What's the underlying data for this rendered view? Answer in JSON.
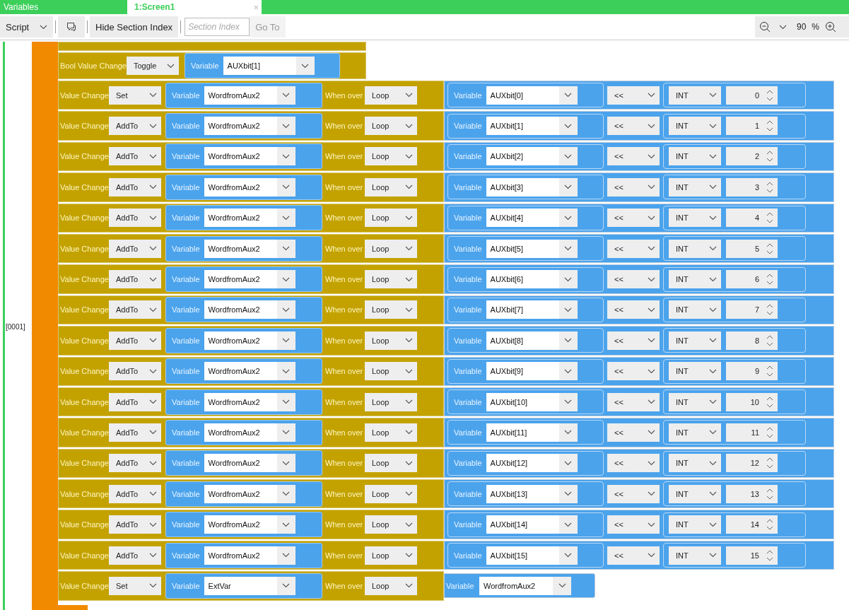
{
  "tabs": [
    {
      "label": "Variables",
      "selected": false
    },
    {
      "label": "1:Screen1",
      "selected": true,
      "close": "×"
    }
  ],
  "toolbar": {
    "mode": "Script",
    "hide_button": "Hide Section Index",
    "section_placeholder": "Section Index",
    "goto": "Go To",
    "goto_disabled": true,
    "zoom": "90",
    "zoom_unit": "%"
  },
  "section_label": "[0001]",
  "blocks": [
    {
      "kind": "partial"
    },
    {
      "kind": "bool",
      "label": "Bool Value Change",
      "op": "Toggle",
      "var_label": "Variable",
      "variable": "AUXbit[1]"
    },
    {
      "kind": "value",
      "label": "Value Change",
      "op": "Set",
      "var_label": "Variable",
      "variable": "WordfromAux2",
      "over_label": "When over",
      "over": "Loop",
      "rhs": {
        "kind": "shift",
        "var_label": "Variable",
        "variable": "AUXbit[0]",
        "operator": "<<",
        "type": "INT",
        "amount": "0"
      }
    },
    {
      "kind": "value",
      "label": "Value Change",
      "op": "AddTo",
      "var_label": "Variable",
      "variable": "WordfromAux2",
      "over_label": "When over",
      "over": "Loop",
      "rhs": {
        "kind": "shift",
        "var_label": "Variable",
        "variable": "AUXbit[1]",
        "operator": "<<",
        "type": "INT",
        "amount": "1"
      }
    },
    {
      "kind": "value",
      "label": "Value Change",
      "op": "AddTo",
      "var_label": "Variable",
      "variable": "WordfromAux2",
      "over_label": "When over",
      "over": "Loop",
      "rhs": {
        "kind": "shift",
        "var_label": "Variable",
        "variable": "AUXbit[2]",
        "operator": "<<",
        "type": "INT",
        "amount": "2"
      }
    },
    {
      "kind": "value",
      "label": "Value Change",
      "op": "AddTo",
      "var_label": "Variable",
      "variable": "WordfromAux2",
      "over_label": "When over",
      "over": "Loop",
      "rhs": {
        "kind": "shift",
        "var_label": "Variable",
        "variable": "AUXbit[3]",
        "operator": "<<",
        "type": "INT",
        "amount": "3"
      }
    },
    {
      "kind": "value",
      "label": "Value Change",
      "op": "AddTo",
      "var_label": "Variable",
      "variable": "WordfromAux2",
      "over_label": "When over",
      "over": "Loop",
      "rhs": {
        "kind": "shift",
        "var_label": "Variable",
        "variable": "AUXbit[4]",
        "operator": "<<",
        "type": "INT",
        "amount": "4"
      }
    },
    {
      "kind": "value",
      "label": "Value Change",
      "op": "AddTo",
      "var_label": "Variable",
      "variable": "WordfromAux2",
      "over_label": "When over",
      "over": "Loop",
      "rhs": {
        "kind": "shift",
        "var_label": "Variable",
        "variable": "AUXbit[5]",
        "operator": "<<",
        "type": "INT",
        "amount": "5"
      }
    },
    {
      "kind": "value",
      "label": "Value Change",
      "op": "AddTo",
      "var_label": "Variable",
      "variable": "WordfromAux2",
      "over_label": "When over",
      "over": "Loop",
      "rhs": {
        "kind": "shift",
        "var_label": "Variable",
        "variable": "AUXbit[6]",
        "operator": "<<",
        "type": "INT",
        "amount": "6"
      }
    },
    {
      "kind": "value",
      "label": "Value Change",
      "op": "AddTo",
      "var_label": "Variable",
      "variable": "WordfromAux2",
      "over_label": "When over",
      "over": "Loop",
      "rhs": {
        "kind": "shift",
        "var_label": "Variable",
        "variable": "AUXbit[7]",
        "operator": "<<",
        "type": "INT",
        "amount": "7"
      }
    },
    {
      "kind": "value",
      "label": "Value Change",
      "op": "AddTo",
      "var_label": "Variable",
      "variable": "WordfromAux2",
      "over_label": "When over",
      "over": "Loop",
      "rhs": {
        "kind": "shift",
        "var_label": "Variable",
        "variable": "AUXbit[8]",
        "operator": "<<",
        "type": "INT",
        "amount": "8"
      }
    },
    {
      "kind": "value",
      "label": "Value Change",
      "op": "AddTo",
      "var_label": "Variable",
      "variable": "WordfromAux2",
      "over_label": "When over",
      "over": "Loop",
      "rhs": {
        "kind": "shift",
        "var_label": "Variable",
        "variable": "AUXbit[9]",
        "operator": "<<",
        "type": "INT",
        "amount": "9"
      }
    },
    {
      "kind": "value",
      "label": "Value Change",
      "op": "AddTo",
      "var_label": "Variable",
      "variable": "WordfromAux2",
      "over_label": "When over",
      "over": "Loop",
      "rhs": {
        "kind": "shift",
        "var_label": "Variable",
        "variable": "AUXbit[10]",
        "operator": "<<",
        "type": "INT",
        "amount": "10"
      }
    },
    {
      "kind": "value",
      "label": "Value Change",
      "op": "AddTo",
      "var_label": "Variable",
      "variable": "WordfromAux2",
      "over_label": "When over",
      "over": "Loop",
      "rhs": {
        "kind": "shift",
        "var_label": "Variable",
        "variable": "AUXbit[11]",
        "operator": "<<",
        "type": "INT",
        "amount": "11"
      }
    },
    {
      "kind": "value",
      "label": "Value Change",
      "op": "AddTo",
      "var_label": "Variable",
      "variable": "WordfromAux2",
      "over_label": "When over",
      "over": "Loop",
      "rhs": {
        "kind": "shift",
        "var_label": "Variable",
        "variable": "AUXbit[12]",
        "operator": "<<",
        "type": "INT",
        "amount": "12"
      }
    },
    {
      "kind": "value",
      "label": "Value Change",
      "op": "AddTo",
      "var_label": "Variable",
      "variable": "WordfromAux2",
      "over_label": "When over",
      "over": "Loop",
      "rhs": {
        "kind": "shift",
        "var_label": "Variable",
        "variable": "AUXbit[13]",
        "operator": "<<",
        "type": "INT",
        "amount": "13"
      }
    },
    {
      "kind": "value",
      "label": "Value Change",
      "op": "AddTo",
      "var_label": "Variable",
      "variable": "WordfromAux2",
      "over_label": "When over",
      "over": "Loop",
      "rhs": {
        "kind": "shift",
        "var_label": "Variable",
        "variable": "AUXbit[14]",
        "operator": "<<",
        "type": "INT",
        "amount": "14"
      }
    },
    {
      "kind": "value",
      "label": "Value Change",
      "op": "AddTo",
      "var_label": "Variable",
      "variable": "WordfromAux2",
      "over_label": "When over",
      "over": "Loop",
      "rhs": {
        "kind": "shift",
        "var_label": "Variable",
        "variable": "AUXbit[15]",
        "operator": "<<",
        "type": "INT",
        "amount": "15"
      }
    },
    {
      "kind": "value",
      "label": "Value Change",
      "op": "Set",
      "var_label": "Variable",
      "variable": "ExtVar",
      "over_label": "When over",
      "over": "Loop",
      "rhs": {
        "kind": "variable",
        "var_label": "Variable",
        "variable": "WordfromAux2"
      }
    }
  ]
}
